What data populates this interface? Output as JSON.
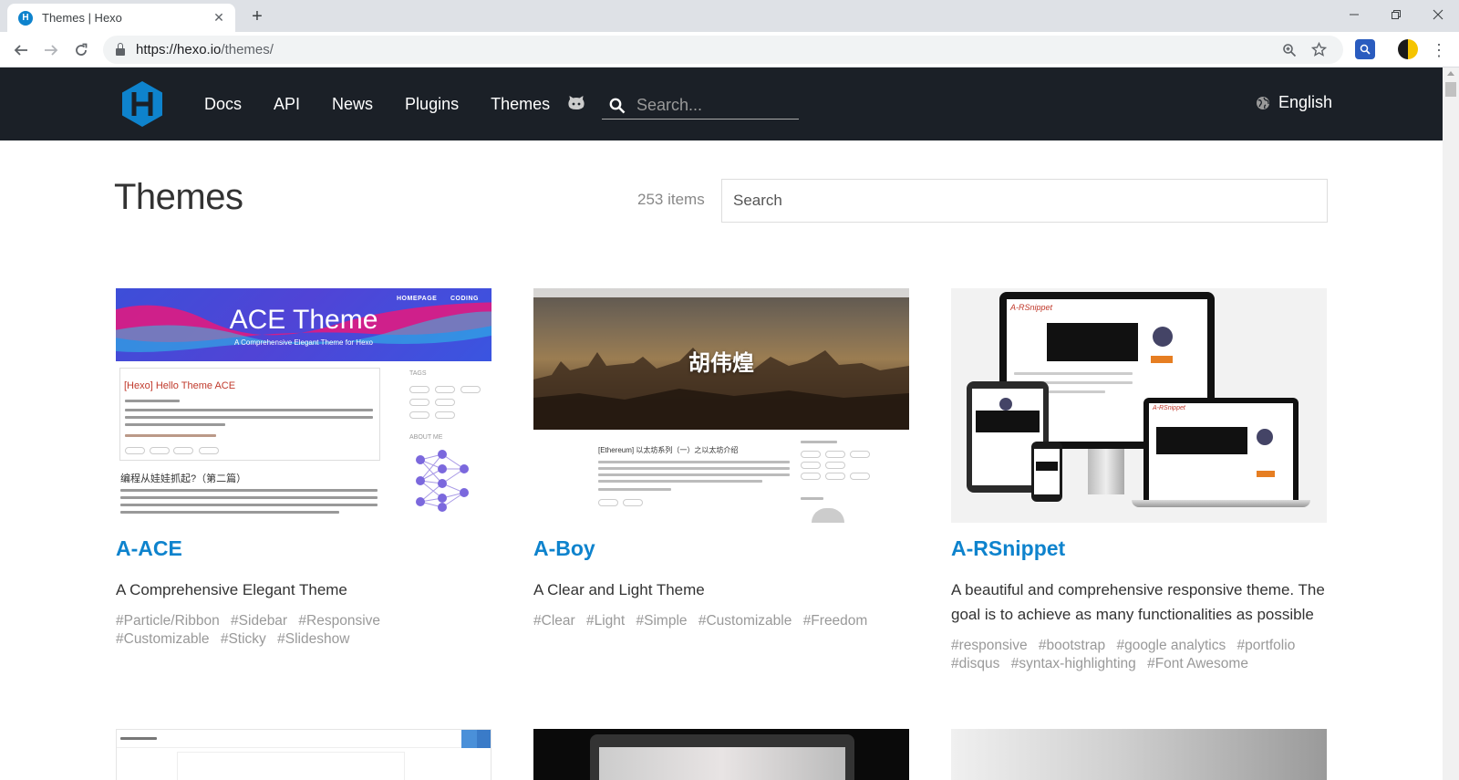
{
  "browser": {
    "tab_title": "Themes | Hexo",
    "tab_favicon_letter": "H",
    "url_host": "https://hexo.io",
    "url_path": "/themes/"
  },
  "header": {
    "nav": [
      "Docs",
      "API",
      "News",
      "Plugins",
      "Themes"
    ],
    "search_placeholder": "Search...",
    "language": "English"
  },
  "page": {
    "title": "Themes",
    "count": "253 items",
    "search_placeholder": "Search"
  },
  "themes": [
    {
      "name": "A-ACE",
      "description": "A Comprehensive Elegant Theme",
      "tags": [
        "#Particle/Ribbon",
        "#Sidebar",
        "#Responsive",
        "#Customizable",
        "#Sticky",
        "#Slideshow"
      ],
      "thumb": {
        "banner_title": "ACE Theme",
        "banner_sub": "A Comprehensive Elegant Theme for Hexo",
        "nav": "HOMEPAGE      CODING",
        "post_title": "[Hexo] Hello Theme ACE",
        "post2_title": "编程从娃娃抓起?（第二篇）",
        "tags_heading": "TAGS",
        "about_heading": "ABOUT ME"
      }
    },
    {
      "name": "A-Boy",
      "description": "A Clear and Light Theme",
      "tags": [
        "#Clear",
        "#Light",
        "#Simple",
        "#Customizable",
        "#Freedom"
      ],
      "thumb": {
        "hero_name": "胡伟煌",
        "post_title": "[Ethereum] 以太坊系列（一）之以太坊介绍"
      }
    },
    {
      "name": "A-RSnippet",
      "description": "A beautiful and comprehensive responsive theme. The goal is to achieve as many functionalities as possible",
      "tags": [
        "#responsive",
        "#bootstrap",
        "#google analytics",
        "#portfolio",
        "#disqus",
        "#syntax-highlighting",
        "#Font Awesome"
      ],
      "thumb": {
        "brand": "A-RSnippet"
      }
    }
  ],
  "colors": {
    "header_bg": "#1b2027",
    "link": "#0e83cd",
    "tag": "#999999"
  }
}
